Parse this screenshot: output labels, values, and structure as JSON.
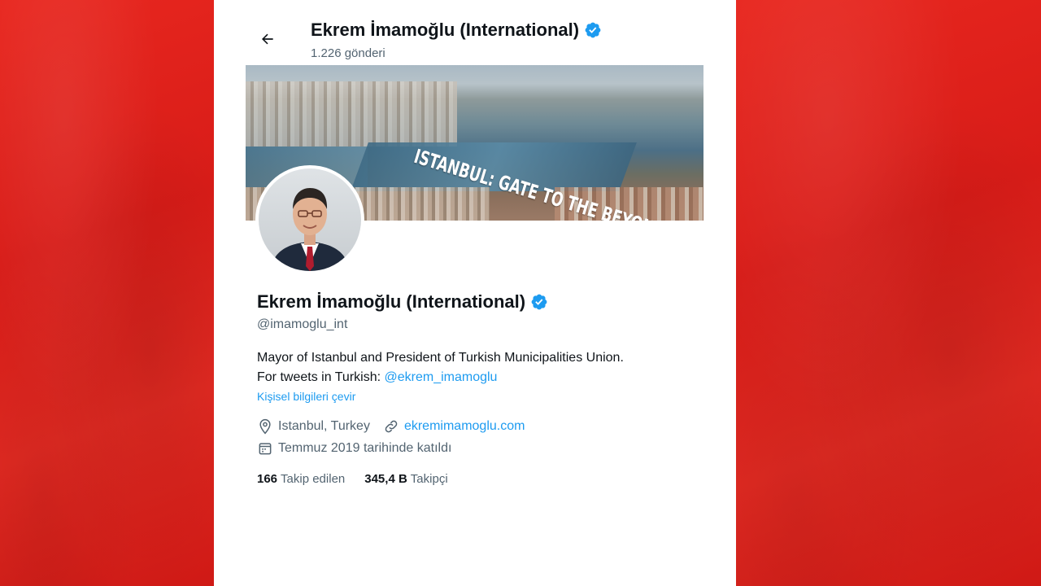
{
  "header": {
    "name": "Ekrem İmamoğlu (International)",
    "post_count": "1.226 gönderi"
  },
  "banner": {
    "slogan": "ISTANBUL: GATE TO THE BEYOND"
  },
  "profile": {
    "name": "Ekrem İmamoğlu (International)",
    "handle": "@imamoglu_int",
    "bio_line1": "Mayor of Istanbul and President of Turkish Municipalities Union.",
    "bio_line2_prefix": "For tweets in Turkish: ",
    "bio_mention": "@ekrem_imamoglu",
    "translate_link": "Kişisel bilgileri çevir",
    "location": "Istanbul, Turkey",
    "website": "ekremimamoglu.com",
    "joined": "Temmuz 2019 tarihinde katıldı",
    "following_count": "166",
    "following_label": "Takip edilen",
    "followers_count": "345,4 B",
    "followers_label": "Takipçi"
  },
  "icons": {
    "back": "arrow-left-icon",
    "verified": "verified-badge-icon",
    "location": "map-pin-icon",
    "link": "link-icon",
    "calendar": "calendar-icon"
  },
  "colors": {
    "accent": "#1d9bf0",
    "background": "#e0201c",
    "text_primary": "#0f1419",
    "text_secondary": "#536471"
  }
}
